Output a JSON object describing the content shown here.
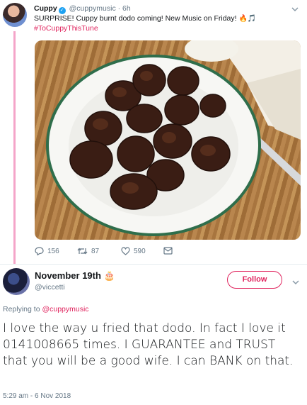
{
  "parent_tweet": {
    "name": "Cuppy",
    "handle": "@cuppymusic",
    "separator": "·",
    "time": "6h",
    "text": "SURPRISE! Cuppy burnt dodo coming! New Music on Friday!",
    "emojis": "🔥🎵",
    "hashtag": "#ToCuppyThisTune",
    "replies": "156",
    "retweets": "87",
    "likes": "590"
  },
  "reply_tweet": {
    "name": "November 19th",
    "name_emoji": "🎂",
    "handle": "@viccetti",
    "follow_label": "Follow",
    "replying_prefix": "Replying to",
    "replying_to": "@cuppymusic",
    "text": "I love the way u fried that dodo. In fact I love it 0141008665 times. I GUARANTEE and TRUST that you will be a good wife. I can BANK on that.",
    "timestamp": "5:29 am - 6 Nov 2018"
  },
  "colors": {
    "accent": "#e0245e",
    "verified": "#1da1f2",
    "muted": "#657786",
    "thread_line": "#f4a5c9"
  }
}
